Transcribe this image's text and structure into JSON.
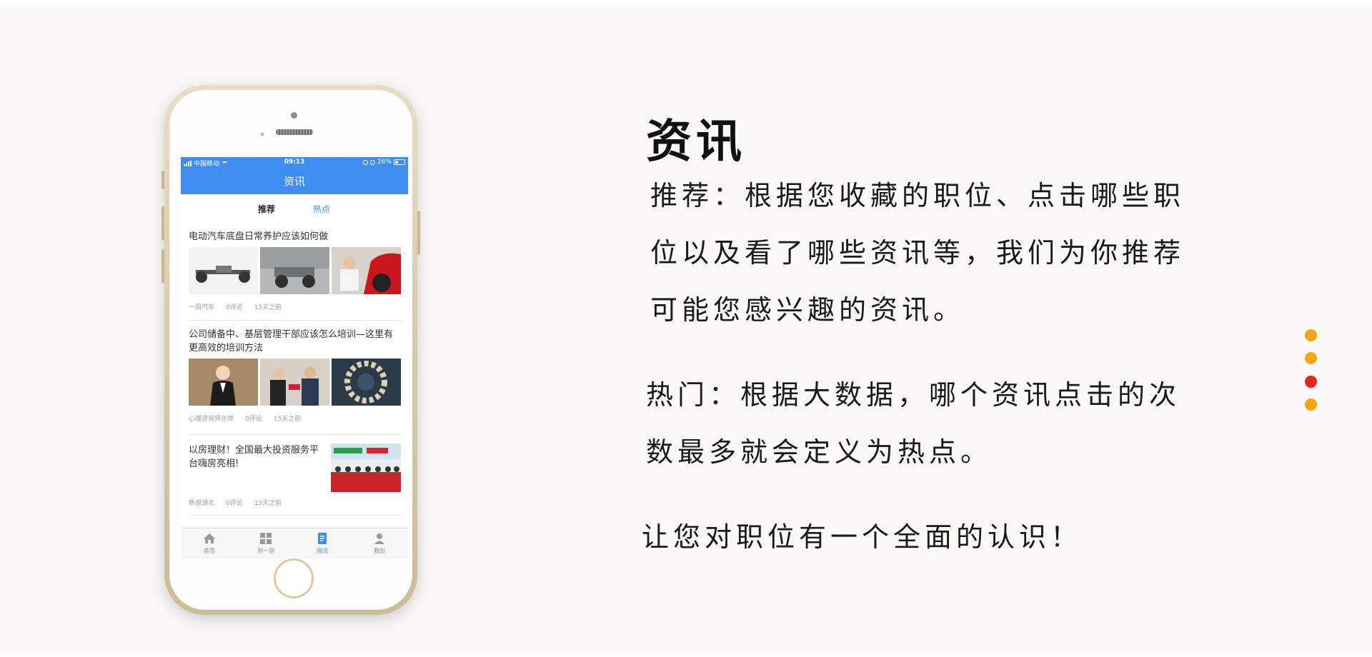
{
  "phone": {
    "status_bar": {
      "carrier": "中国移动",
      "time": "09:13",
      "battery": "26%"
    },
    "header_title": "资讯",
    "tabs": [
      {
        "label": "推荐",
        "active": true
      },
      {
        "label": "热点",
        "active": false
      }
    ],
    "articles": [
      {
        "title": "电动汽车底盘日常养护应该如何做",
        "source": "一周汽车",
        "comments": "0评论",
        "time": "15天之前"
      },
      {
        "title": "公司储备中、基层管理干部应该怎么培训—这里有更高效的培训方法",
        "source": "心理咨询师许烨",
        "comments": "0评论",
        "time": "15天之前"
      },
      {
        "title": "以房理财！全国最大投资服务平台嗨房亮相!",
        "source": "新浪湖北",
        "comments": "0评论",
        "time": "15天之前"
      }
    ],
    "tabbar": [
      {
        "label": "首页",
        "icon": "home-icon",
        "active": false
      },
      {
        "label": "测一测",
        "icon": "grid-icon",
        "active": false
      },
      {
        "label": "资讯",
        "icon": "news-icon",
        "active": true
      },
      {
        "label": "我的",
        "icon": "user-icon",
        "active": false
      }
    ]
  },
  "content": {
    "title": "资讯",
    "recommend_text": "推荐：根据您收藏的职位、点击哪些职位以及看了哪些资讯等，我们为你推荐可能您感兴趣的资讯。",
    "hot_text": "热门：根据大数据，哪个资讯点击的次数最多就会定义为热点。",
    "closing_text": "让您对职位有一个全面的认识！"
  },
  "pager": {
    "dots": [
      "#f5a511",
      "#f5a511",
      "#e8221c",
      "#f5a511"
    ],
    "active_index": 2
  },
  "colors": {
    "accent": "#3d8ef0",
    "background": "#faf9f5"
  }
}
